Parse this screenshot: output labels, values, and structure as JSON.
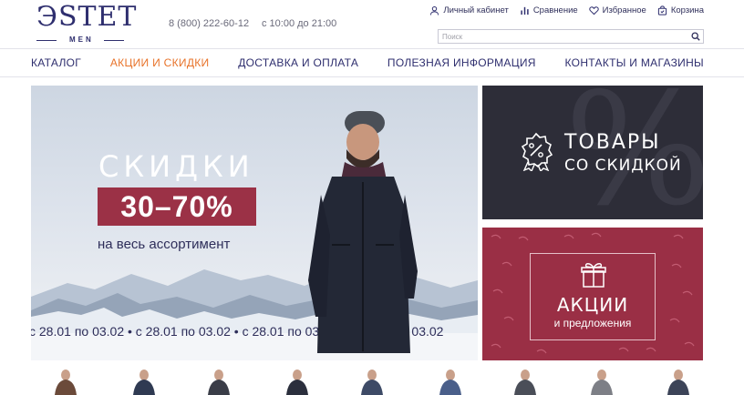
{
  "logo": {
    "main": "ЭSTET",
    "sub": "MEN"
  },
  "header": {
    "phone": "8 (800) 222-60-12",
    "hours": "с 10:00 до 21:00"
  },
  "user_links": [
    {
      "label": "Личный кабинет",
      "icon": "user-icon"
    },
    {
      "label": "Сравнение",
      "icon": "bar-chart-icon"
    },
    {
      "label": "Избранное",
      "icon": "heart-icon"
    },
    {
      "label": "Корзина",
      "icon": "basket-icon"
    }
  ],
  "search": {
    "placeholder": "Поиск",
    "value": ""
  },
  "nav": [
    {
      "label": "КАТАЛОГ",
      "active": false
    },
    {
      "label": "АКЦИИ И СКИДКИ",
      "active": true
    },
    {
      "label": "ДОСТАВКА И ОПЛАТА",
      "active": false
    },
    {
      "label": "ПОЛЕЗНАЯ ИНФОРМАЦИЯ",
      "active": false
    },
    {
      "label": "КОНТАКТЫ И МАГАЗИНЫ",
      "active": false
    }
  ],
  "hero": {
    "title": "СКИДКИ",
    "badge": "30–70%",
    "subtitle": "на весь ассортимент",
    "dates": "с 28.01 по 03.02  •  с 28.01 по 03.02  •  с 28.01 по 03.02  •  с 28.01 по 03.02"
  },
  "promo_sale": {
    "line1": "ТОВАРЫ",
    "line2": "СО СКИДКОЙ",
    "icon": "discount-badge-icon",
    "symbol": "%"
  },
  "promo_actions": {
    "line1": "АКЦИИ",
    "line2": "и предложения",
    "icon": "gift-icon"
  },
  "colors": {
    "brand": "#2e2e6e",
    "accent": "#e8732a",
    "badge": "#9b3146",
    "dark_panel": "#2d2d38",
    "wine_panel": "#9a2f45"
  },
  "thumbnails_count": 9
}
